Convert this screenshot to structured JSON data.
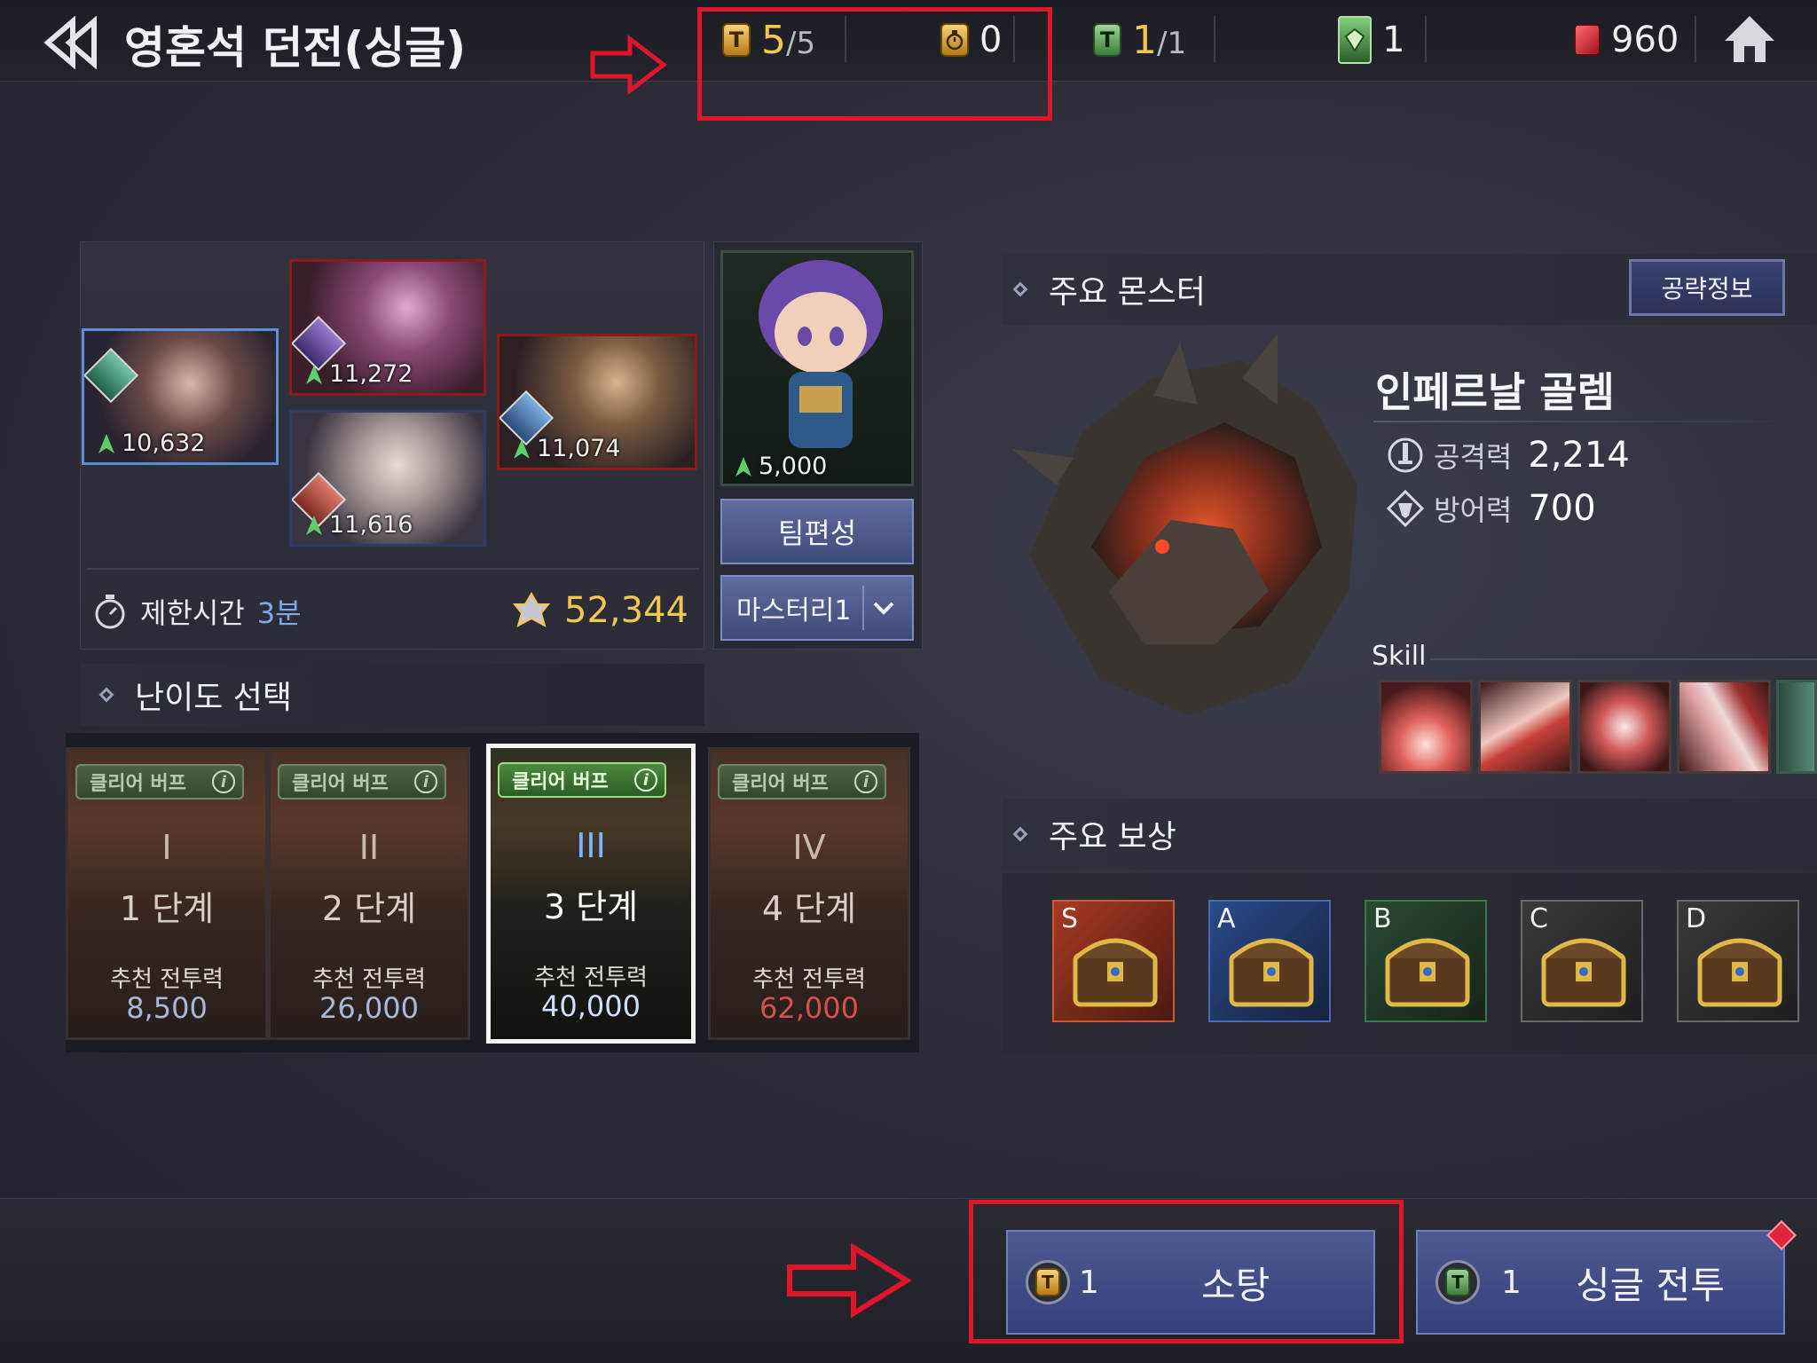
{
  "header": {
    "title": "영혼석 던전(싱글)",
    "resources": {
      "dungeon_ticket": {
        "current": "5",
        "max": "/5"
      },
      "stopwatch": {
        "value": "0"
      },
      "ticket2": {
        "current": "1",
        "max": "/1"
      },
      "green_card": {
        "value": "1"
      },
      "ruby": {
        "value": "960"
      }
    }
  },
  "team": {
    "heroes": [
      {
        "power": "10,632"
      },
      {
        "power": "11,272"
      },
      {
        "power": "11,616"
      },
      {
        "power": "11,074"
      }
    ],
    "pet": {
      "power": "5,000"
    },
    "time_limit_label": "제한시간",
    "time_limit_value": "3분",
    "total_power": "52,344",
    "team_button": "팀편성",
    "mastery_select": "마스터리1"
  },
  "difficulty": {
    "title": "난이도 선택",
    "buff_label": "클리어 버프",
    "rec_label": "추천 전투력",
    "stages": [
      {
        "numeral": "I",
        "name": "1 단계",
        "rec_power": "8,500"
      },
      {
        "numeral": "II",
        "name": "2 단계",
        "rec_power": "26,000"
      },
      {
        "numeral": "III",
        "name": "3 단계",
        "rec_power": "40,000"
      },
      {
        "numeral": "IV",
        "name": "4 단계",
        "rec_power": "62,000"
      }
    ],
    "selected_index": 2
  },
  "monster": {
    "section_title": "주요 몬스터",
    "guide_button": "공략정보",
    "name": "인페르날 골렘",
    "attack_label": "공격력",
    "attack_value": "2,214",
    "defense_label": "방어력",
    "defense_value": "700",
    "skill_label": "Skill"
  },
  "rewards": {
    "section_title": "주요 보상",
    "grades": [
      "S",
      "A",
      "B",
      "C",
      "D"
    ]
  },
  "actions": {
    "sweep": {
      "count": "1",
      "label": "소탕"
    },
    "single_battle": {
      "count": "1",
      "label": "싱글 전투"
    }
  },
  "colors": {
    "accent_gold": "#f3c64e",
    "annotation_red": "#e0152a",
    "button_blue": "#4c5a92"
  }
}
